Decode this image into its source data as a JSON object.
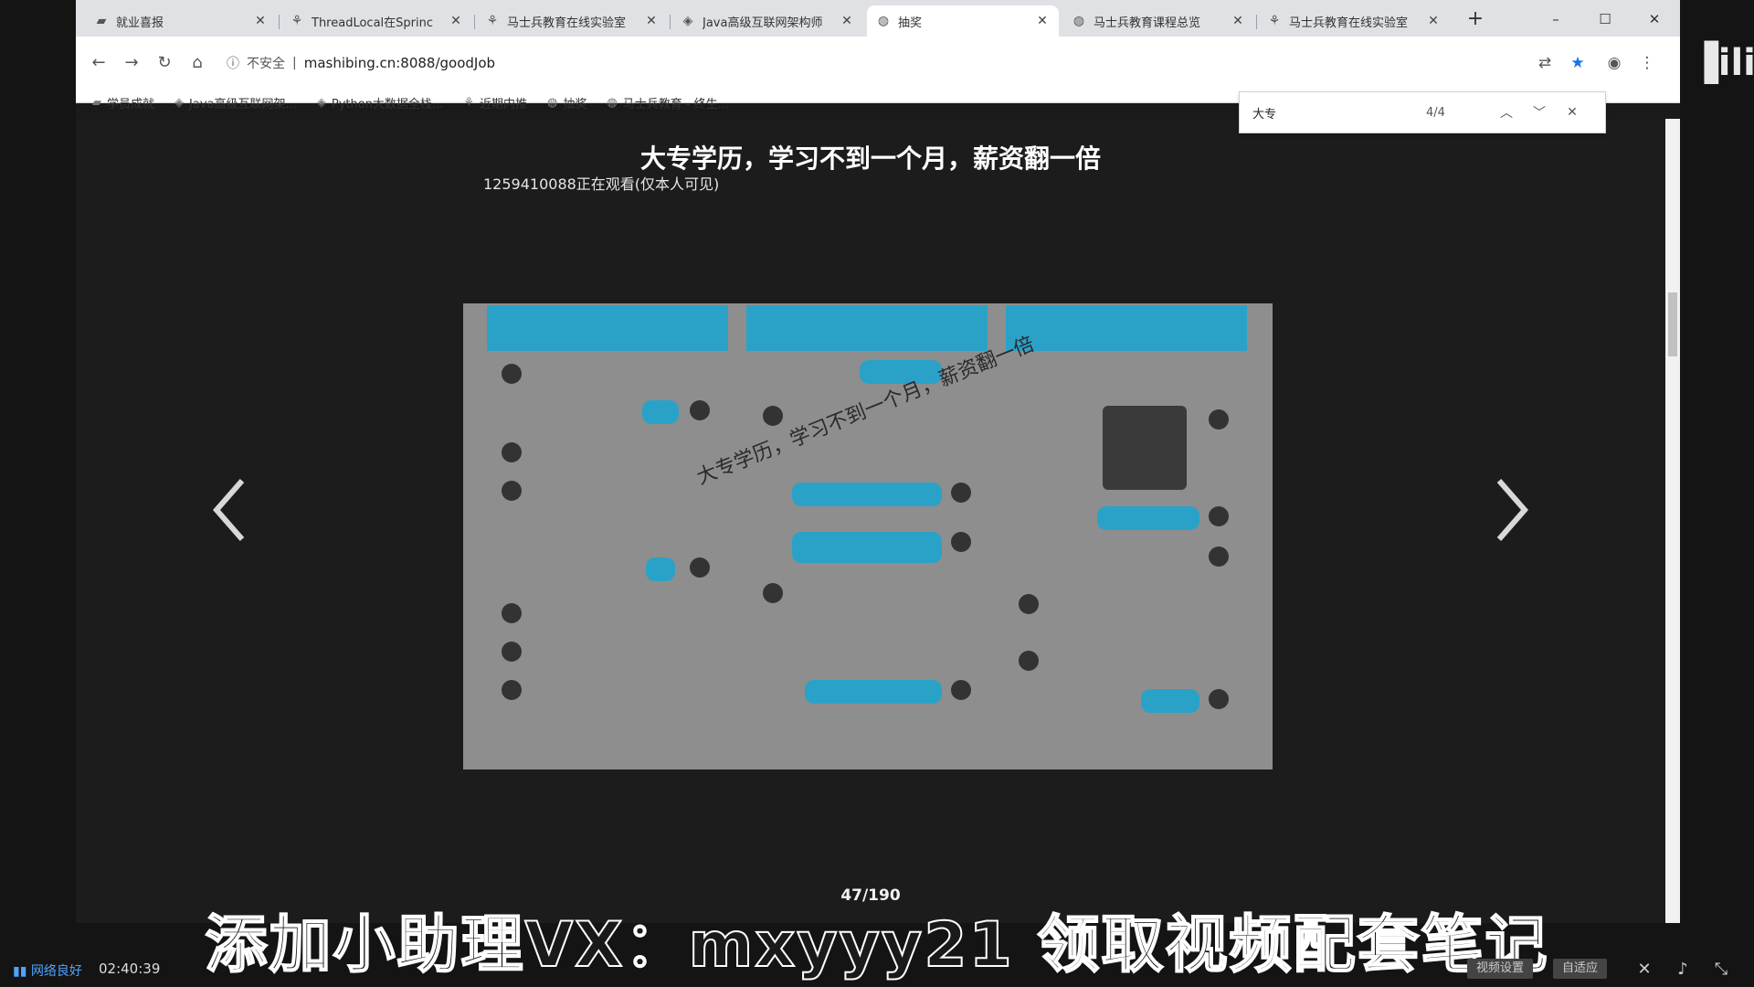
{
  "tabs": [
    {
      "label": "就业喜报",
      "icon": "folder-icon",
      "active": false
    },
    {
      "label": "ThreadLocal在Sprinc",
      "icon": "spider-icon",
      "active": false
    },
    {
      "label": "马士兵教育在线实验室",
      "icon": "spider-icon",
      "active": false
    },
    {
      "label": "Java高级互联网架构师",
      "icon": "diamond-icon",
      "active": false
    },
    {
      "label": "抽奖",
      "icon": "globe-icon",
      "active": true
    },
    {
      "label": "马士兵教育课程总览",
      "icon": "globe-icon",
      "active": false
    },
    {
      "label": "马士兵教育在线实验室",
      "icon": "spider-icon",
      "active": false
    }
  ],
  "toolbar": {
    "security_label": "不安全",
    "url": "mashibing.cn:8088/goodJob"
  },
  "bookmarks": [
    {
      "label": "学员成就",
      "icon": "folder-icon"
    },
    {
      "label": "Java高级互联网架...",
      "icon": "diamond-icon"
    },
    {
      "label": "Python大数据全栈...",
      "icon": "diamond-icon"
    },
    {
      "label": "近期内推",
      "icon": "spider-icon"
    },
    {
      "label": "抽奖",
      "icon": "globe-icon"
    },
    {
      "label": "马士兵教育 - 终生...",
      "icon": "globe-icon"
    }
  ],
  "find": {
    "query": "大专",
    "count": "4/4"
  },
  "slide": {
    "title": "大专学历，学习不到一个月，薪资翻一倍",
    "watching": "1259410088正在观看(仅本人可见)",
    "watermark": "大专学历，学习不到一个月，薪资翻一倍",
    "counter": "47/190"
  },
  "player": {
    "subtitle": "添加小助理VX：mxyyy21 领取视频配套笔记",
    "network": "网络良好",
    "time": "02:40:39",
    "btn_settings": "视频设置",
    "btn_auto": "自适应"
  }
}
